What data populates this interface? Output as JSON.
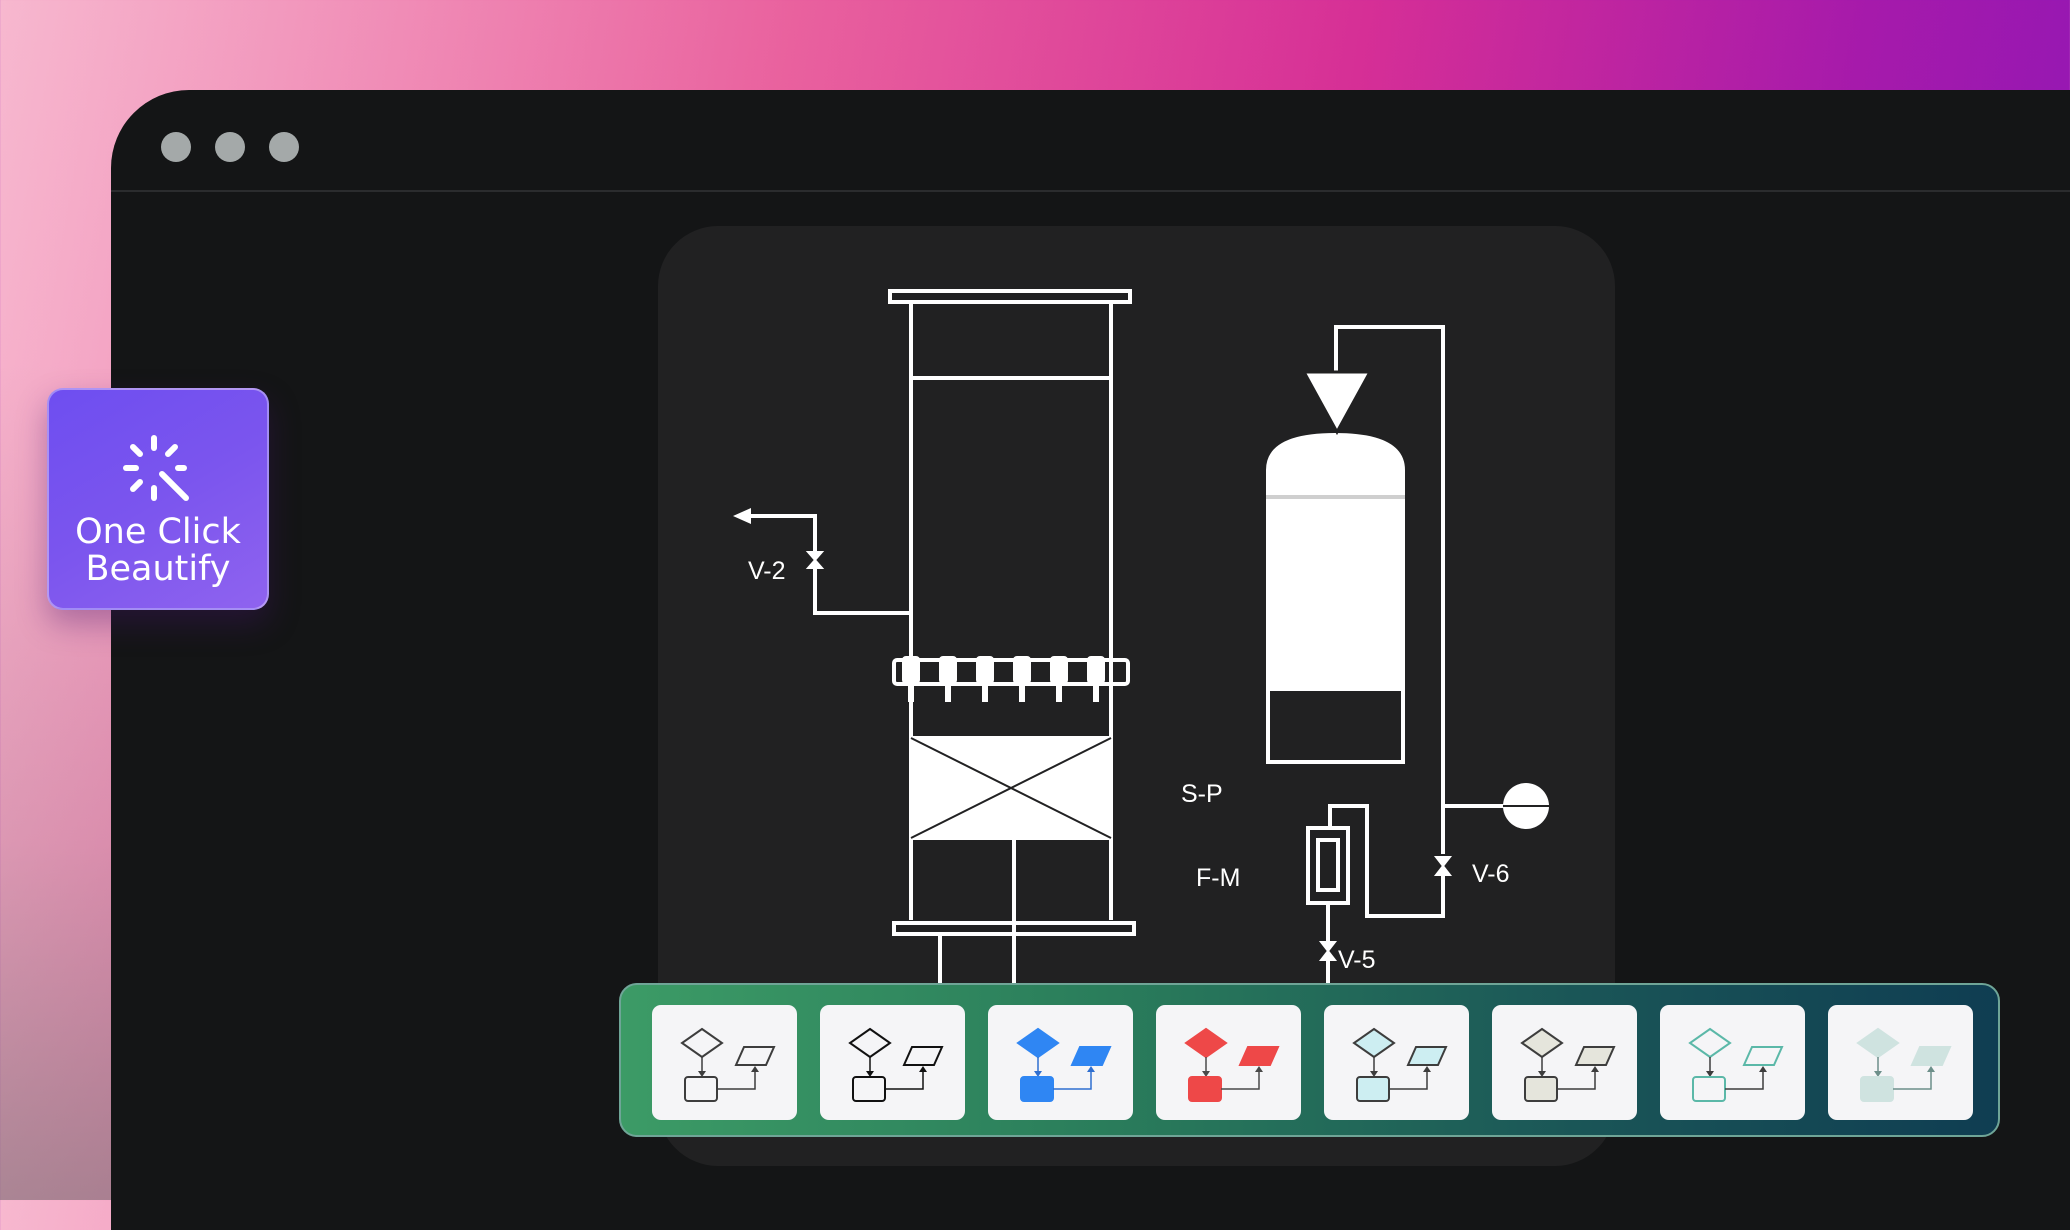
{
  "window": {
    "traffic_lights": [
      "window-dot-1",
      "window-dot-2",
      "window-dot-3"
    ]
  },
  "beautify": {
    "label_line1": "One Click",
    "label_line2": "Beautify",
    "icon": "magic-wand-sparkle-icon"
  },
  "diagram": {
    "labels": {
      "v2": "V-2",
      "sp": "S-P",
      "fm": "F-M",
      "v6": "V-6",
      "v5": "V-5"
    }
  },
  "style_toolbar": {
    "themes": [
      {
        "name": "outline-light",
        "fill_diamond": "none",
        "fill_para": "none",
        "fill_rect": "none",
        "stroke": "#3d3d3d",
        "line": "#3d3d3d"
      },
      {
        "name": "outline-dark",
        "fill_diamond": "none",
        "fill_para": "none",
        "fill_rect": "none",
        "stroke": "#111111",
        "line": "#111111"
      },
      {
        "name": "blue",
        "fill_diamond": "#2f86f3",
        "fill_para": "#2f86f3",
        "fill_rect": "#2f86f3",
        "stroke": "#2f86f3",
        "line": "#2f6fd0"
      },
      {
        "name": "red",
        "fill_diamond": "#ee4848",
        "fill_para": "#ee4848",
        "fill_rect": "#ee4848",
        "stroke": "#ee4848",
        "line": "#4a4a4a"
      },
      {
        "name": "light-cyan",
        "fill_diamond": "#cdeef2",
        "fill_para": "#cdeef2",
        "fill_rect": "#cdeef2",
        "stroke": "#3d3d3d",
        "line": "#3d3d3d"
      },
      {
        "name": "beige-gray",
        "fill_diamond": "#e5e5dc",
        "fill_para": "#e5e5dc",
        "fill_rect": "#e5e5dc",
        "stroke": "#3d3d3d",
        "line": "#3d3d3d"
      },
      {
        "name": "teal-outline",
        "fill_diamond": "none",
        "fill_para": "none",
        "fill_rect": "none",
        "stroke": "#5bb8a8",
        "line": "#3d3d3d"
      },
      {
        "name": "soft-teal",
        "fill_diamond": "#cfe3e0",
        "fill_para": "#cfe3e0",
        "fill_rect": "#cfe3e0",
        "stroke": "#cfe3e0",
        "line": "#6d8f8a"
      }
    ]
  }
}
